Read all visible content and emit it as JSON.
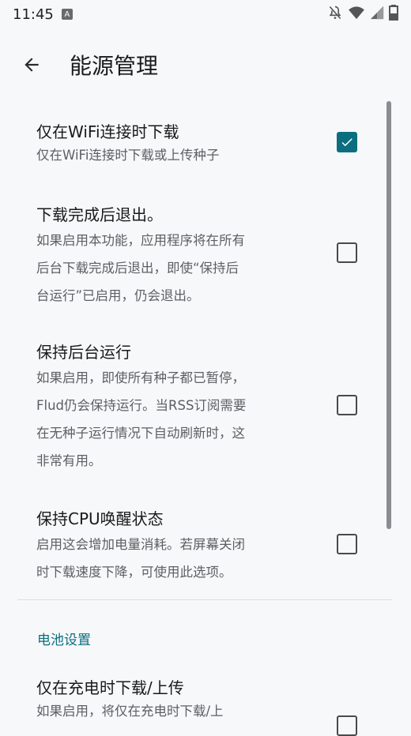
{
  "status_bar": {
    "time": "11:45",
    "a_icon_text": "A"
  },
  "toolbar": {
    "title": "能源管理"
  },
  "prefs": [
    {
      "title": "仅在WiFi连接时下载",
      "summary": "仅在WiFi连接时下载或上传种子",
      "checked": true
    },
    {
      "title": "下载完成后退出。",
      "summary_lines": [
        "如果启用本功能，应用程序将在所有",
        "后台下载完成后退出，即使“保持后",
        "台运行”已启用，仍会退出。"
      ],
      "checked": false
    },
    {
      "title": "保持后台运行",
      "summary_lines": [
        "如果启用，即使所有种子都已暂停，",
        "Flud仍会保持运行。当RSS订阅需要",
        "在无种子运行情况下自动刷新时，这",
        "非常有用。"
      ],
      "checked": false
    },
    {
      "title": "保持CPU唤醒状态",
      "summary_lines": [
        "启用这会增加电量消耗。若屏幕关闭",
        "时下载速度下降，可使用此选项。"
      ],
      "checked": false
    },
    {
      "title": "仅在充电时下载/上传",
      "summary_lines": [
        "如果启用，将仅在充电时下载/上"
      ],
      "checked": false
    }
  ],
  "category": {
    "battery": "电池设置"
  },
  "colors": {
    "accent": "#0B6E7F",
    "background": "#F6F8FA"
  },
  "icons": [
    "back-arrow-icon",
    "notifications-off-icon",
    "wifi-icon",
    "signal-icon",
    "battery-icon",
    "check-icon"
  ]
}
